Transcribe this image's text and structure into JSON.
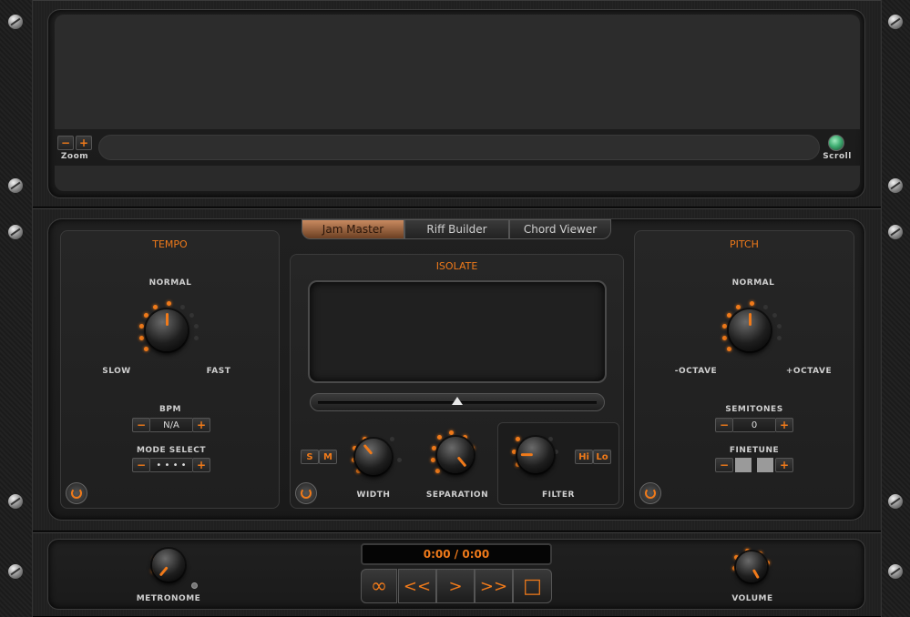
{
  "waveform": {
    "zoom_minus": "−",
    "zoom_plus": "+",
    "zoom_label": "Zoom",
    "scroll_label": "Scroll"
  },
  "tabs": [
    {
      "label": "Jam Master",
      "active": true
    },
    {
      "label": "Riff Builder",
      "active": false
    },
    {
      "label": "Chord Viewer",
      "active": false
    }
  ],
  "tempo": {
    "title": "TEMPO",
    "normal_label": "NORMAL",
    "slow_label": "SLOW",
    "fast_label": "FAST",
    "bpm_label": "BPM",
    "bpm_value": "N/A",
    "mode_label": "MODE SELECT",
    "mode_value": "• • • •",
    "minus": "−",
    "plus": "+"
  },
  "isolate": {
    "title": "ISOLATE",
    "s_label": "S",
    "m_label": "M",
    "width_label": "WIDTH",
    "separation_label": "SEPARATION",
    "filter_label": "FILTER",
    "hi_label": "Hi",
    "lo_label": "Lo",
    "slider_position": 0.5
  },
  "pitch": {
    "title": "PITCH",
    "normal_label": "NORMAL",
    "minus_octave_label": "-OCTAVE",
    "plus_octave_label": "+OCTAVE",
    "semitones_label": "SEMITONES",
    "semitones_value": "0",
    "finetune_label": "FINETUNE",
    "minus": "−",
    "plus": "+"
  },
  "transport": {
    "time": "0:00 / 0:00",
    "loop_icon": "∞",
    "rewind_icon": "<<",
    "play_icon": ">",
    "forward_icon": ">>",
    "stop_icon": "□",
    "metronome_label": "METRONOME",
    "volume_label": "VOLUME"
  },
  "colors": {
    "accent": "#f07a1a",
    "tab_active": "#c98a60",
    "scroll_led": "#3fae72"
  }
}
